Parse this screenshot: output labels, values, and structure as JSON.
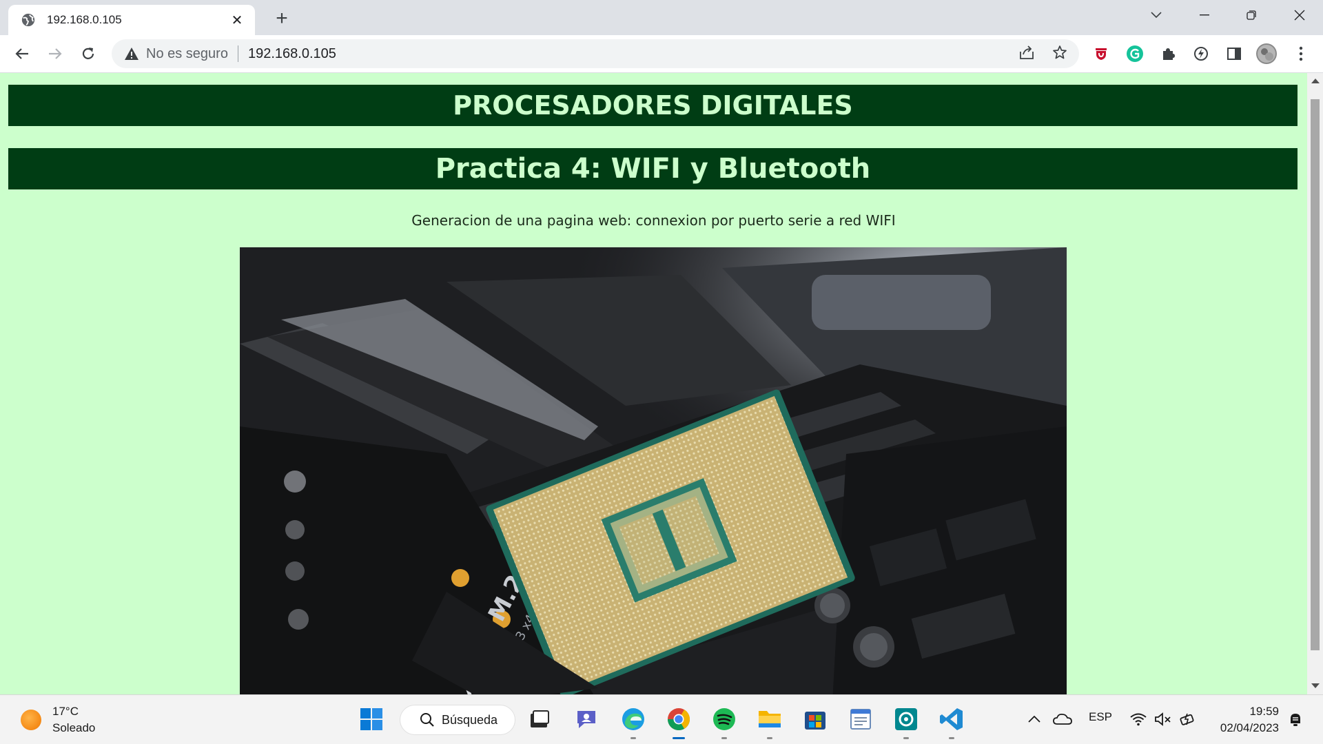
{
  "browser": {
    "tab": {
      "title": "192.168.0.105",
      "favicon": "globe-icon"
    },
    "address_bar": {
      "security_label": "No es seguro",
      "url": "192.168.0.105"
    }
  },
  "page": {
    "heading1": "PROCESADORES DIGITALES",
    "heading2": "Practica 4: WIFI y Bluetooth",
    "subtitle": "Generacion de una pagina web: connexion por puerto serie a red WIFI",
    "image": {
      "subject": "cpu-on-motherboard-photo",
      "visible_text": [
        "Ultra M.2",
        "PCIe Gen3 x4",
        "M.2"
      ]
    },
    "background_color": "#ccffcc",
    "banner_color": "#003d14",
    "banner_text_color": "#ccffcc"
  },
  "taskbar": {
    "weather": {
      "temp": "17°C",
      "condition": "Soleado"
    },
    "search_label": "Búsqueda",
    "language": "ESP",
    "time": "19:59",
    "date": "02/04/2023"
  }
}
